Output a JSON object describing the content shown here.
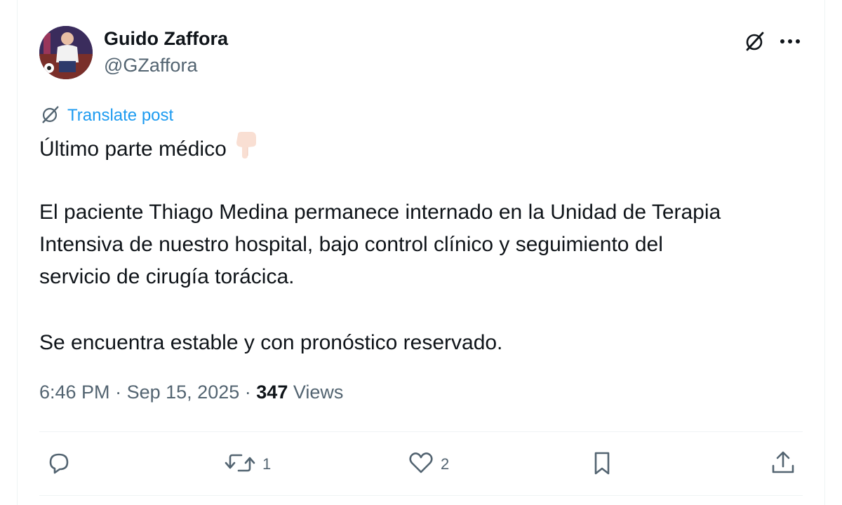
{
  "author": {
    "name": "Guido Zaffora",
    "handle": "@GZaffora"
  },
  "header": {
    "grok_icon": "grok-icon",
    "more_icon": "more-icon"
  },
  "translate": {
    "label": "Translate post",
    "icon": "grok-icon"
  },
  "post": {
    "line1": "Último parte médico",
    "line1_emoji": "backhand-index-pointing-down",
    "para2_line1": "El paciente Thiago Medina permanece internado en la Unidad de Terapia",
    "para2_line2": "Intensiva de nuestro hospital, bajo control clínico y seguimiento del",
    "para2_line3": "servicio de cirugía torácica.",
    "para3": "Se encuentra estable y con pronóstico reservado."
  },
  "meta": {
    "time": "6:46 PM",
    "separator": "·",
    "date": "Sep 15, 2025",
    "views_count": "347",
    "views_label": "Views"
  },
  "actions": {
    "reply_count": "",
    "repost_count": "1",
    "like_count": "2"
  },
  "colors": {
    "text": "#0f1419",
    "secondary": "#536471",
    "accent": "#1d9bf0",
    "divider": "#eff3f4"
  }
}
